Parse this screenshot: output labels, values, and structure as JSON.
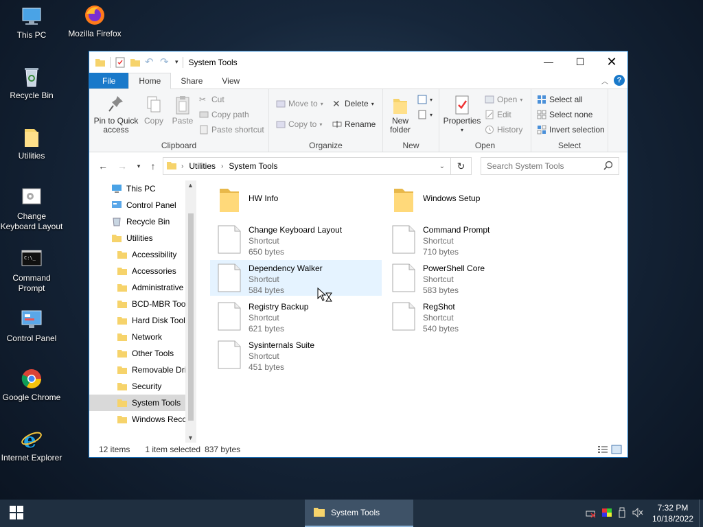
{
  "desktop": {
    "icons": [
      {
        "label": "This PC",
        "icon": "this-pc-icon"
      },
      {
        "label": "Mozilla Firefox",
        "icon": "firefox-icon"
      },
      {
        "label": "Recycle Bin",
        "icon": "recycle-bin-icon"
      },
      {
        "label": "Utilities",
        "icon": "folder-icon"
      },
      {
        "label": "Change Keyboard Layout",
        "icon": "keyboard-layout-icon"
      },
      {
        "label": "Command Prompt",
        "icon": "command-prompt-icon"
      },
      {
        "label": "Control Panel",
        "icon": "control-panel-icon"
      },
      {
        "label": "Google Chrome",
        "icon": "chrome-icon"
      },
      {
        "label": "Internet Explorer",
        "icon": "internet-explorer-icon"
      }
    ]
  },
  "window": {
    "title": "System Tools",
    "tabs": {
      "file": "File",
      "home": "Home",
      "share": "Share",
      "view": "View"
    },
    "ribbon": {
      "clipboard": {
        "label": "Clipboard",
        "pin": "Pin to Quick access",
        "copy": "Copy",
        "paste": "Paste",
        "cut": "Cut",
        "copy_path": "Copy path",
        "paste_shortcut": "Paste shortcut"
      },
      "organize": {
        "label": "Organize",
        "move_to": "Move to",
        "copy_to": "Copy to",
        "delete": "Delete",
        "rename": "Rename"
      },
      "new": {
        "label": "New",
        "new_folder": "New folder"
      },
      "open": {
        "label": "Open",
        "properties": "Properties",
        "open": "Open",
        "edit": "Edit",
        "history": "History"
      },
      "select": {
        "label": "Select",
        "select_all": "Select all",
        "select_none": "Select none",
        "invert": "Invert selection"
      }
    },
    "address": {
      "parts": [
        "Utilities",
        "System Tools"
      ]
    },
    "search": {
      "placeholder": "Search System Tools"
    },
    "nav": [
      {
        "label": "This PC",
        "icon": "this-pc-icon",
        "indent": 0
      },
      {
        "label": "Control Panel",
        "icon": "control-panel-icon",
        "indent": 0
      },
      {
        "label": "Recycle Bin",
        "icon": "recycle-bin-icon",
        "indent": 0
      },
      {
        "label": "Utilities",
        "icon": "folder-icon",
        "indent": 0
      },
      {
        "label": "Accessibility",
        "icon": "folder-icon",
        "indent": 1
      },
      {
        "label": "Accessories",
        "icon": "folder-icon",
        "indent": 1
      },
      {
        "label": "Administrative",
        "icon": "folder-icon",
        "indent": 1
      },
      {
        "label": "BCD-MBR Tool",
        "icon": "folder-icon",
        "indent": 1
      },
      {
        "label": "Hard Disk Tools",
        "icon": "folder-icon",
        "indent": 1
      },
      {
        "label": "Network",
        "icon": "folder-icon",
        "indent": 1
      },
      {
        "label": "Other Tools",
        "icon": "folder-icon",
        "indent": 1
      },
      {
        "label": "Removable Dri",
        "icon": "folder-icon",
        "indent": 1
      },
      {
        "label": "Security",
        "icon": "folder-icon",
        "indent": 1
      },
      {
        "label": "System Tools",
        "icon": "folder-icon",
        "indent": 1,
        "selected": true
      },
      {
        "label": "Windows Reco",
        "icon": "folder-icon",
        "indent": 1
      }
    ],
    "items": [
      {
        "name": "HW Info",
        "type": "folder"
      },
      {
        "name": "Windows Setup",
        "type": "folder"
      },
      {
        "name": "Change Keyboard Layout",
        "type": "Shortcut",
        "size": "650 bytes"
      },
      {
        "name": "Command Prompt",
        "type": "Shortcut",
        "size": "710 bytes"
      },
      {
        "name": "Dependency Walker",
        "type": "Shortcut",
        "size": "584 bytes",
        "selected": true
      },
      {
        "name": "PowerShell Core",
        "type": "Shortcut",
        "size": "583 bytes"
      },
      {
        "name": "Registry Backup",
        "type": "Shortcut",
        "size": "621 bytes"
      },
      {
        "name": "RegShot",
        "type": "Shortcut",
        "size": "540 bytes"
      },
      {
        "name": "Sysinternals Suite",
        "type": "Shortcut",
        "size": "451 bytes"
      }
    ],
    "status": {
      "count": "12 items",
      "selected": "1 item selected",
      "size": "837 bytes"
    }
  },
  "taskbar": {
    "app": "System Tools",
    "time": "7:32 PM",
    "date": "10/18/2022"
  },
  "colors": {
    "accent": "#1979ca",
    "selection": "#e5f3ff",
    "taskbar": "#1f2f40"
  }
}
